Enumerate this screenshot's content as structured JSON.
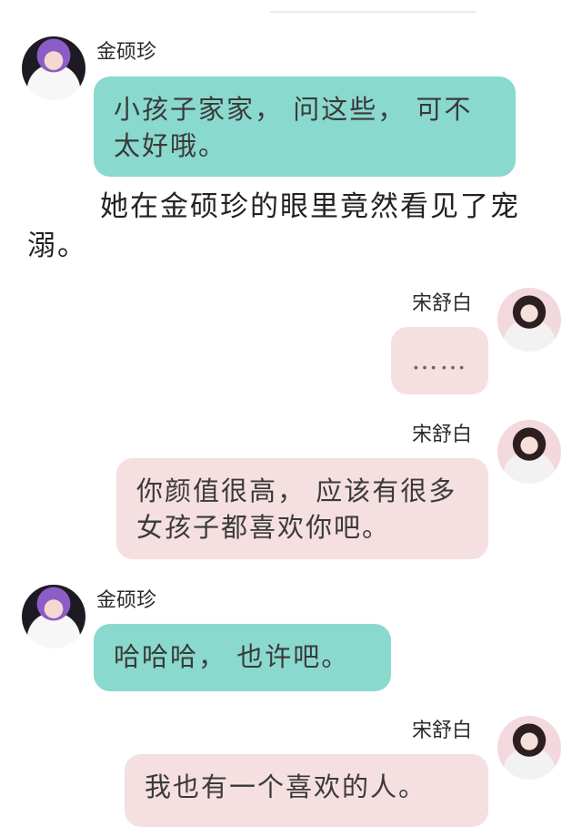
{
  "messages": [
    {
      "sender": "金硕珍",
      "side": "left",
      "color": "#8ad9ce",
      "text": "小孩子家家， 问这些， 可不太好哦。"
    },
    {
      "narration": "她在金硕珍的眼里竟然看见了宠溺。"
    },
    {
      "sender": "宋舒白",
      "side": "right",
      "color": "#f5dfe0",
      "text": "……"
    },
    {
      "sender": "宋舒白",
      "side": "right",
      "color": "#f5dfe0",
      "text": "你颜值很高， 应该有很多女孩子都喜欢你吧。"
    },
    {
      "sender": "金硕珍",
      "side": "left",
      "color": "#8ad9ce",
      "text": "哈哈哈， 也许吧。"
    },
    {
      "sender": "宋舒白",
      "side": "right",
      "color": "#f5dfe0",
      "text": "我也有一个喜欢的人。"
    }
  ],
  "icons": {
    "male_avatar": "avatar-jin-icon",
    "female_avatar": "avatar-song-icon"
  }
}
